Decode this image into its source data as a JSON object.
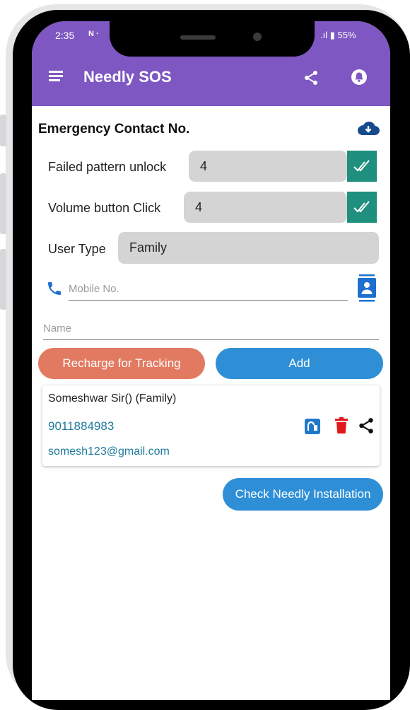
{
  "status_bar": {
    "time": "2:35",
    "app_glyph": "N ·",
    "right": ".ıl ▮ 55%"
  },
  "app_bar": {
    "title": "Needly SOS",
    "colors": {
      "accent": "#7e57c2"
    }
  },
  "section": {
    "title": "Emergency Contact No."
  },
  "rows": {
    "failed_pattern": {
      "label": "Failed pattern unlock",
      "value": "4"
    },
    "volume_click": {
      "label": "Volume button Click",
      "value": "4"
    },
    "user_type": {
      "label": "User Type",
      "value": "Family"
    }
  },
  "inputs": {
    "mobile": {
      "placeholder": "Mobile No.",
      "value": ""
    },
    "name": {
      "placeholder": "Name",
      "value": ""
    }
  },
  "buttons": {
    "recharge": {
      "label": "Recharge for Tracking",
      "color": "#e27a62"
    },
    "add": {
      "label": "Add",
      "color": "#2f8fd6"
    },
    "check_install": {
      "label": "Check Needly Installation",
      "color": "#2f8fd6"
    }
  },
  "contact_card": {
    "name": "Someshwar Sir() (Family)",
    "phone": "9011884983",
    "email": "somesh123@gmail.com"
  },
  "icons": [
    "menu-icon",
    "share-icon",
    "bell-icon",
    "cloud-download-icon",
    "check-icon",
    "phone-icon",
    "contact-book-icon",
    "edit-icon",
    "delete-icon"
  ]
}
